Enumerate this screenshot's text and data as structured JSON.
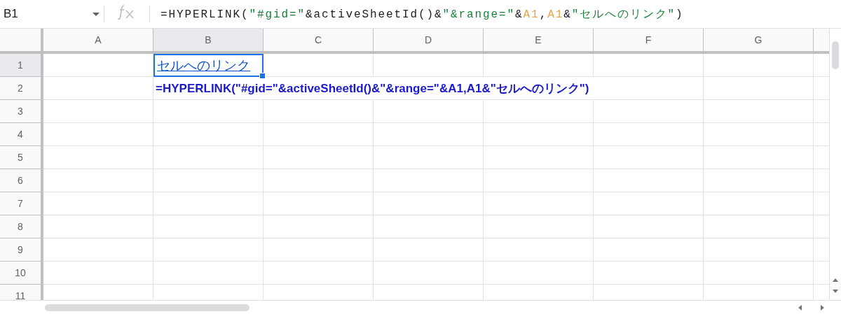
{
  "name_box": {
    "value": "B1"
  },
  "formula_bar": {
    "tokens": [
      {
        "text": "=HYPERLINK(",
        "kind": "plain"
      },
      {
        "text": "\"#gid=\"",
        "kind": "string"
      },
      {
        "text": "&activeSheetId()&",
        "kind": "plain"
      },
      {
        "text": "\"&range=\"",
        "kind": "string"
      },
      {
        "text": "&",
        "kind": "plain"
      },
      {
        "text": "A1",
        "kind": "reference"
      },
      {
        "text": ",",
        "kind": "plain"
      },
      {
        "text": "A1",
        "kind": "reference"
      },
      {
        "text": "&",
        "kind": "plain"
      },
      {
        "text": "\"セルへのリンク\"",
        "kind": "string"
      },
      {
        "text": ")",
        "kind": "plain"
      }
    ]
  },
  "columns": [
    {
      "label": "A",
      "selected": false
    },
    {
      "label": "B",
      "selected": true
    },
    {
      "label": "C",
      "selected": false
    },
    {
      "label": "D",
      "selected": false
    },
    {
      "label": "E",
      "selected": false
    },
    {
      "label": "F",
      "selected": false
    },
    {
      "label": "G",
      "selected": false
    }
  ],
  "rows": [
    {
      "label": "1",
      "selected": true,
      "column_b": {
        "text": "セルへのリンク",
        "kind": "link",
        "selected": true
      }
    },
    {
      "label": "2",
      "selected": false,
      "column_b": {
        "text": "=HYPERLINK(\"#gid=\"&activeSheetId()&\"&range=\"&A1,A1&\"セルへのリンク\")",
        "kind": "overflow",
        "selected": false
      }
    },
    {
      "label": "3",
      "selected": false
    },
    {
      "label": "4",
      "selected": false
    },
    {
      "label": "5",
      "selected": false
    },
    {
      "label": "6",
      "selected": false
    },
    {
      "label": "7",
      "selected": false
    },
    {
      "label": "8",
      "selected": false
    },
    {
      "label": "9",
      "selected": false
    },
    {
      "label": "10",
      "selected": false
    },
    {
      "label": "11",
      "selected": false
    }
  ]
}
